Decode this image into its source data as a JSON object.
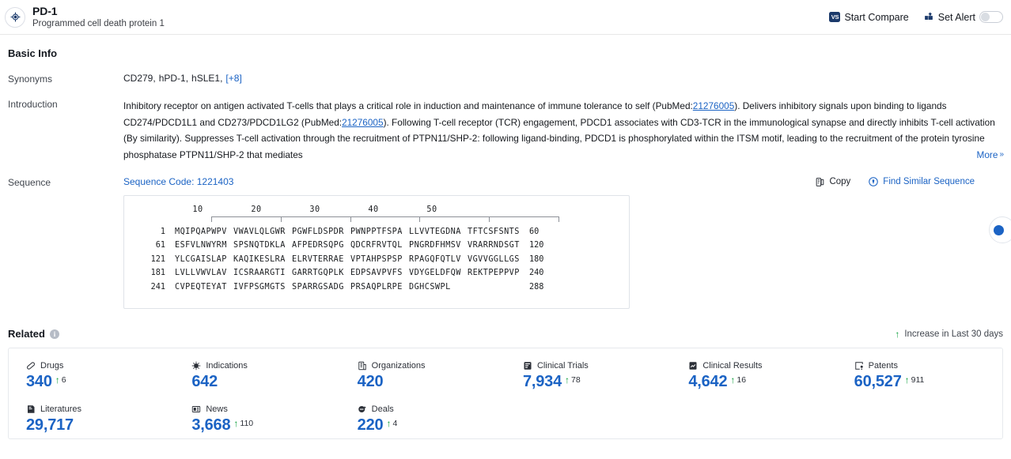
{
  "header": {
    "logo_icon": "target-crosshair-icon",
    "title": "PD-1",
    "subtitle": "Programmed cell death protein 1",
    "start_compare_label": "Start Compare",
    "vs_badge": "VS",
    "set_alert_label": "Set Alert",
    "alert_toggle_state": "off"
  },
  "basic_info": {
    "section_title": "Basic Info",
    "synonyms_label": "Synonyms",
    "synonyms": [
      "CD279,",
      "hPD-1,",
      "hSLE1,"
    ],
    "synonyms_more": "[+8]",
    "introduction_label": "Introduction",
    "introduction": {
      "p1": "Inhibitory receptor on antigen activated T-cells that plays a critical role in induction and maintenance of immune tolerance to self (PubMed:",
      "link1": "21276005",
      "p2": "). Delivers inhibitory signals upon binding to ligands CD274/PDCD1L1 and CD273/PDCD1LG2 (PubMed:",
      "link2": "21276005",
      "p3": "). Following T-cell receptor (TCR) engagement, PDCD1 associates with CD3-TCR in the immunological synapse and directly inhibits T-cell activation (By similarity). Suppresses T-cell activation through the recruitment of PTPN11/SHP-2: following ligand-binding, PDCD1 is phosphorylated within the ITSM motif, leading to the recruitment of the protein tyrosine phosphatase PTPN11/SHP-2 that mediates",
      "more_label": "More",
      "more_icon": "double-chevron-down-icon"
    }
  },
  "sequence": {
    "label": "Sequence",
    "code_text": "Sequence Code: 1221403",
    "copy_label": "Copy",
    "copy_icon": "copy-icon",
    "find_similar_label": "Find Similar Sequence",
    "find_similar_icon": "compass-icon",
    "ruler_ticks": [
      "10",
      "20",
      "30",
      "40",
      "50"
    ],
    "rows": [
      {
        "start": "1",
        "chunks": [
          "MQIPQAPWPV",
          "VWAVLQLGWR",
          "PGWFLDSPDR",
          "PWNPPTFSPA",
          "LLVVTEGDNA",
          "TFTCSFSNTS"
        ],
        "end": "60"
      },
      {
        "start": "61",
        "chunks": [
          "ESFVLNWYRM",
          "SPSNQTDKLA",
          "AFPEDRSQPG",
          "QDCRFRVTQL",
          "PNGRDFHMSV",
          "VRARRNDSGT"
        ],
        "end": "120"
      },
      {
        "start": "121",
        "chunks": [
          "YLCGAISLAP",
          "KAQIKESLRA",
          "ELRVTERRAE",
          "VPTAHPSPSP",
          "RPAGQFQTLV",
          "VGVVGGLLGS"
        ],
        "end": "180"
      },
      {
        "start": "181",
        "chunks": [
          "LVLLVWVLAV",
          "ICSRAARGTI",
          "GARRTGQPLK",
          "EDPSAVPVFS",
          "VDYGELDFQW",
          "REKTPEPPVP"
        ],
        "end": "240"
      },
      {
        "start": "241",
        "chunks": [
          "CVPEQTEYAT",
          "IVFPSGMGTS",
          "SPARRGSADG",
          "PRSAQPLRPE",
          "DGHCSWPL",
          ""
        ],
        "end": "288"
      }
    ]
  },
  "related": {
    "title": "Related",
    "info_icon": "info-icon",
    "legend_icon": "arrow-up-icon",
    "legend_label": "Increase in Last 30 days",
    "cards": [
      {
        "icon": "capsule-icon",
        "label": "Drugs",
        "value": "340",
        "delta": "6"
      },
      {
        "icon": "virus-icon",
        "label": "Indications",
        "value": "642",
        "delta": ""
      },
      {
        "icon": "building-icon",
        "label": "Organizations",
        "value": "420",
        "delta": ""
      },
      {
        "icon": "clipboard-trial-icon",
        "label": "Clinical Trials",
        "value": "7,934",
        "delta": "78"
      },
      {
        "icon": "chart-results-icon",
        "label": "Clinical Results",
        "value": "4,642",
        "delta": "16"
      },
      {
        "icon": "patent-icon",
        "label": "Patents",
        "value": "60,527",
        "delta": "911"
      },
      {
        "icon": "book-icon",
        "label": "Literatures",
        "value": "29,717",
        "delta": ""
      },
      {
        "icon": "news-icon",
        "label": "News",
        "value": "3,668",
        "delta": "110"
      },
      {
        "icon": "handshake-icon",
        "label": "Deals",
        "value": "220",
        "delta": "4"
      }
    ]
  },
  "colors": {
    "accent_blue": "#1b63c4",
    "increase_green": "#0e9f3c",
    "border": "#e6e9ed"
  }
}
